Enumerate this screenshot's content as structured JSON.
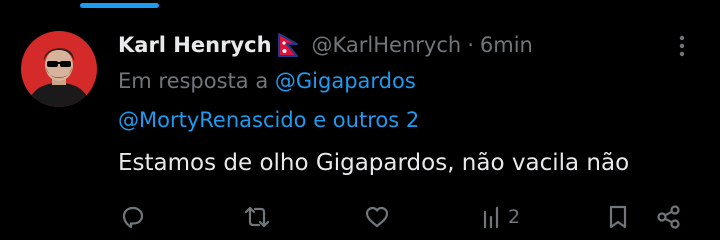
{
  "tweet": {
    "display_name": "Karl Henrych",
    "handle": "@KarlHenrych",
    "separator": "·",
    "timestamp": "6min",
    "reply_prefix": "Em resposta a",
    "reply_to_1": "@Gigapardos",
    "reply_to_2": "@MortyRenascido",
    "reply_suffix": "e outros 2",
    "text": "Estamos de olho Gigapardos, não vacila não"
  },
  "actions": {
    "views_count": "2"
  },
  "icons": {
    "flag": "nepal-flag-icon",
    "more": "more-vertical-icon",
    "reply": "reply-icon",
    "retweet": "retweet-icon",
    "like": "heart-icon",
    "views": "views-icon",
    "bookmark": "bookmark-icon",
    "share": "share-icon"
  },
  "colors": {
    "background": "#000000",
    "accent": "#1d9bf0",
    "text_primary": "#e7e9ea",
    "text_secondary": "#71767b",
    "avatar_bg": "#d42a2a"
  }
}
